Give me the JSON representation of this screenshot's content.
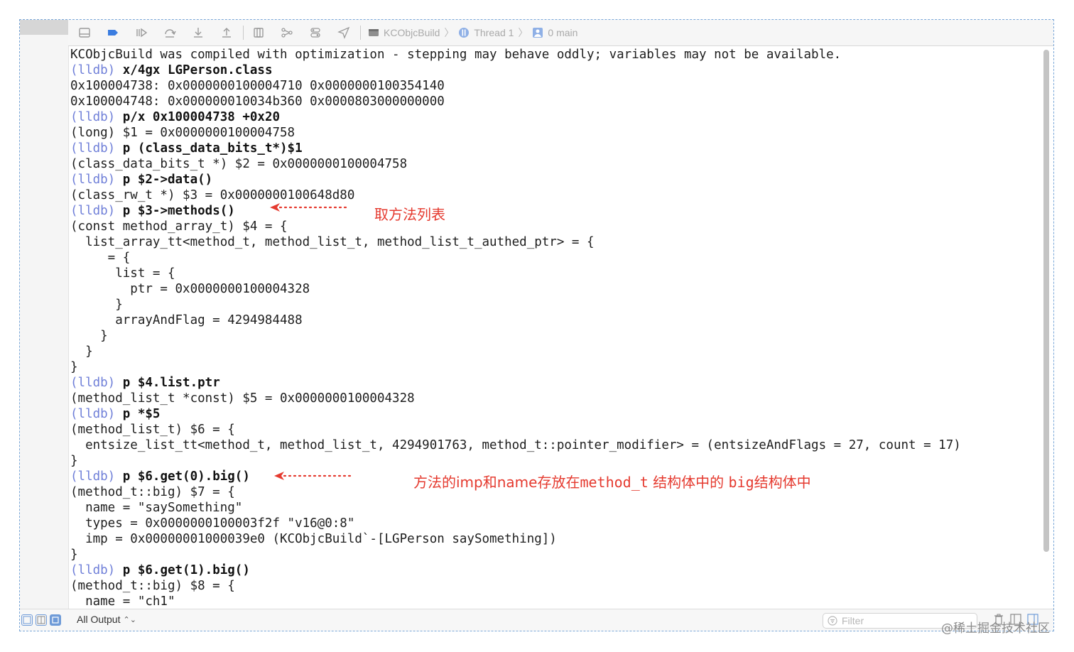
{
  "toolbar": {
    "icons": [
      "hide-panel-icon",
      "breakpoint-icon",
      "continue-icon",
      "step-over-icon",
      "step-into-icon",
      "step-out-icon",
      "debug-view-hierarchy-icon",
      "memory-graph-icon",
      "environment-overrides-icon",
      "location-icon"
    ],
    "breadcrumbs": [
      "KCObjcBuild",
      "Thread 1",
      "0 main"
    ]
  },
  "console": {
    "lines": [
      {
        "kind": "output",
        "text": "KCObjcBuild was compiled with optimization - stepping may behave oddly; variables may not be available."
      },
      {
        "kind": "command",
        "prompt": "(lldb)",
        "cmd": "x/4gx LGPerson.class"
      },
      {
        "kind": "output",
        "text": "0x100004738: 0x0000000100004710 0x0000000100354140"
      },
      {
        "kind": "output",
        "text": "0x100004748: 0x000000010034b360 0x0000803000000000"
      },
      {
        "kind": "command",
        "prompt": "(lldb)",
        "cmd": "p/x 0x100004738 +0x20"
      },
      {
        "kind": "output",
        "text": "(long) $1 = 0x0000000100004758"
      },
      {
        "kind": "command",
        "prompt": "(lldb)",
        "cmd": "p (class_data_bits_t*)$1"
      },
      {
        "kind": "output",
        "text": "(class_data_bits_t *) $2 = 0x0000000100004758"
      },
      {
        "kind": "command",
        "prompt": "(lldb)",
        "cmd": "p $2->data()"
      },
      {
        "kind": "output",
        "text": "(class_rw_t *) $3 = 0x0000000100648d80"
      },
      {
        "kind": "command",
        "prompt": "(lldb)",
        "cmd": "p $3->methods()"
      },
      {
        "kind": "output",
        "text": "(const method_array_t) $4 = {"
      },
      {
        "kind": "output",
        "text": "  list_array_tt<method_t, method_list_t, method_list_t_authed_ptr> = {"
      },
      {
        "kind": "output",
        "text": "     = {"
      },
      {
        "kind": "output",
        "text": "      list = {"
      },
      {
        "kind": "output",
        "text": "        ptr = 0x0000000100004328"
      },
      {
        "kind": "output",
        "text": "      }"
      },
      {
        "kind": "output",
        "text": "      arrayAndFlag = 4294984488"
      },
      {
        "kind": "output",
        "text": "    }"
      },
      {
        "kind": "output",
        "text": "  }"
      },
      {
        "kind": "output",
        "text": "}"
      },
      {
        "kind": "command",
        "prompt": "(lldb)",
        "cmd": "p $4.list.ptr"
      },
      {
        "kind": "output",
        "text": "(method_list_t *const) $5 = 0x0000000100004328"
      },
      {
        "kind": "command",
        "prompt": "(lldb)",
        "cmd": "p *$5"
      },
      {
        "kind": "output",
        "text": "(method_list_t) $6 = {"
      },
      {
        "kind": "output",
        "text": "  entsize_list_tt<method_t, method_list_t, 4294901763, method_t::pointer_modifier> = (entsizeAndFlags = 27, count = 17)"
      },
      {
        "kind": "output",
        "text": "}"
      },
      {
        "kind": "command",
        "prompt": "(lldb)",
        "cmd": "p $6.get(0).big()"
      },
      {
        "kind": "output",
        "text": "(method_t::big) $7 = {"
      },
      {
        "kind": "output",
        "text": "  name = \"saySomething\""
      },
      {
        "kind": "output",
        "text": "  types = 0x0000000100003f2f \"v16@0:8\""
      },
      {
        "kind": "output",
        "text": "  imp = 0x00000001000039e0 (KCObjcBuild`-[LGPerson saySomething])"
      },
      {
        "kind": "output",
        "text": "}"
      },
      {
        "kind": "command",
        "prompt": "(lldb)",
        "cmd": "p $6.get(1).big()"
      },
      {
        "kind": "output",
        "text": "(method_t::big) $8 = {"
      },
      {
        "kind": "output",
        "text": "  name = \"ch1\""
      }
    ]
  },
  "annotations": {
    "methods_note": "取方法列表",
    "big_note_prefix": "方法的imp和name存放在",
    "big_note_mono1": "method_t",
    "big_note_mid": " 结构体中的 ",
    "big_note_mono2": "big",
    "big_note_suffix": "结构体中",
    "color": "#e53a2f"
  },
  "bottom_bar": {
    "output_label": "All Output",
    "filter_placeholder": "Filter"
  },
  "watermark": "@稀土掘金技术社区"
}
